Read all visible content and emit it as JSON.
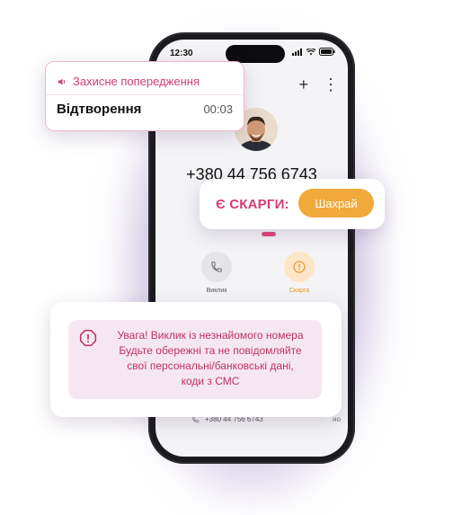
{
  "status_bar": {
    "time": "12:30"
  },
  "contact": {
    "phone_number": "+380 44 756 6743",
    "top_actions": {
      "add": "+",
      "more": "⋮"
    }
  },
  "actions": [
    {
      "label": "Виклик",
      "icon": "phone-icon"
    },
    {
      "label": "Скарга",
      "icon": "warning-circle-icon"
    }
  ],
  "history": {
    "number": "+380 44 756 6743",
    "side_text": "но"
  },
  "warning_player": {
    "header": "Захисне попередження",
    "title": "Відтворення",
    "duration": "00:03"
  },
  "complaints": {
    "label": "Є СКАРГИ:",
    "badge": "Шахрай"
  },
  "alert": {
    "lines": [
      "Увага! Виклик із незнайомого номера",
      "Будьте обережні та не повідомляйте",
      "свої персональні/банковські дані,",
      "коди з СМС"
    ]
  },
  "colors": {
    "accent_pink": "#d83a72",
    "badge_orange": "#f0a93a",
    "alert_bg": "#f5e7f2"
  }
}
